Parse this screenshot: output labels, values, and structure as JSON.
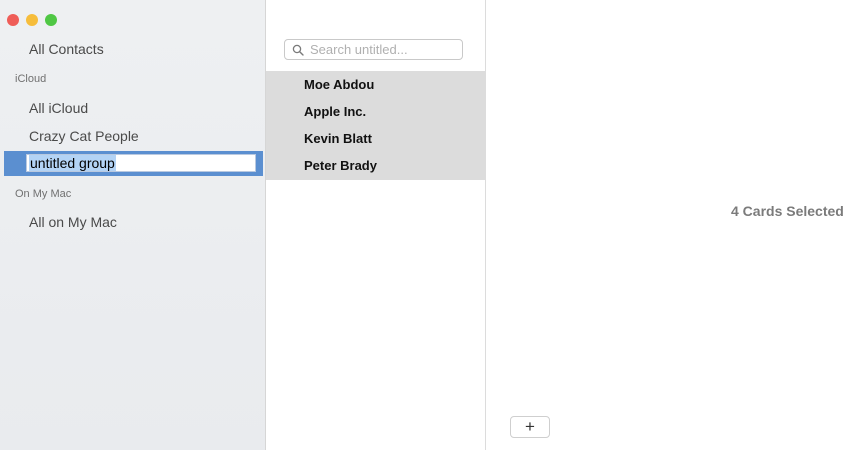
{
  "window": {
    "traffic_lights": [
      {
        "name": "close",
        "color": "#ef5d58"
      },
      {
        "name": "minimize",
        "color": "#f6bd3b"
      },
      {
        "name": "zoom",
        "color": "#4fc744"
      }
    ]
  },
  "sidebar": {
    "all_contacts": "All Contacts",
    "sections": [
      {
        "title": "iCloud",
        "items": [
          "All iCloud",
          "Crazy Cat People"
        ],
        "editing_item": "untitled group"
      },
      {
        "title": "On My Mac",
        "items": [
          "All on My Mac"
        ]
      }
    ],
    "selection_color": "#5b8fd0"
  },
  "list": {
    "search_placeholder": "Search untitled...",
    "search_icon": "search-icon",
    "contacts": [
      "Moe Abdou",
      "Apple Inc.",
      "Kevin Blatt",
      "Peter Brady"
    ]
  },
  "detail": {
    "selection_text": "4 Cards Selected",
    "add_button": "+"
  }
}
